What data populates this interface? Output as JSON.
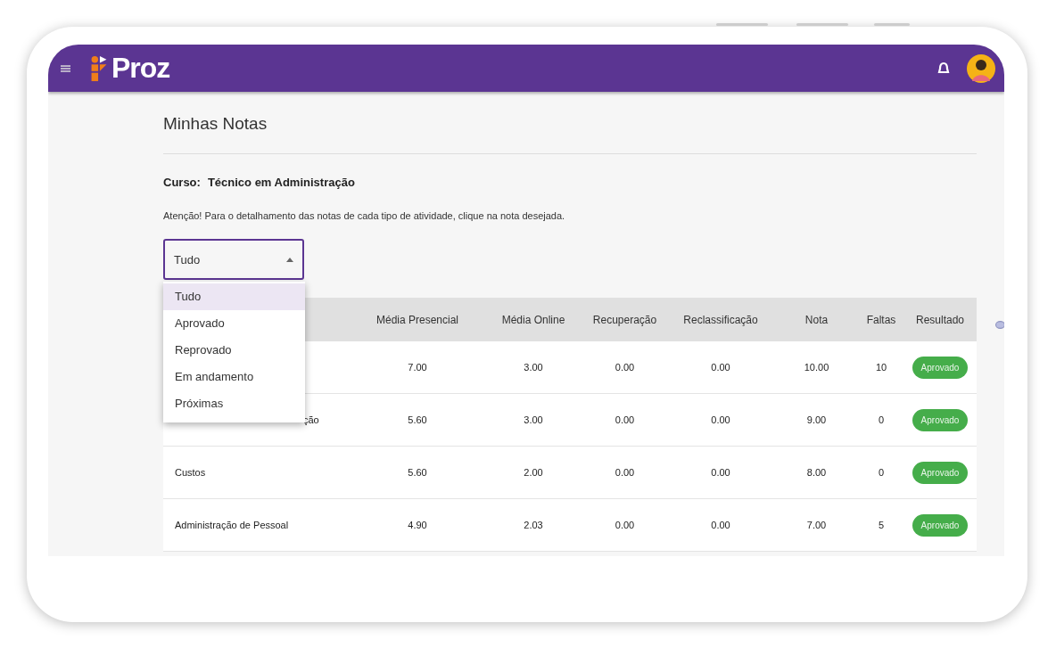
{
  "app_bar": {
    "logo": "Proz"
  },
  "page_title": "Minhas Notas",
  "course": {
    "label": "Curso:",
    "value": "Técnico em Administração"
  },
  "notice": "Atenção! Para o detalhamento das notas de cada tipo de atividade, clique na nota desejada.",
  "filter": {
    "value": "Tudo",
    "expanded": true,
    "options": [
      {
        "label": "Tudo",
        "selected": true
      },
      {
        "label": "Aprovado",
        "selected": false
      },
      {
        "label": "Reprovado",
        "selected": false
      },
      {
        "label": "Em andamento",
        "selected": false
      },
      {
        "label": "Próximas",
        "selected": false
      }
    ]
  },
  "table": {
    "columns": [
      "Média Presencial",
      "Média Online",
      "Recuperação",
      "Reclassificação",
      "Nota",
      "Faltas",
      "Resultado"
    ],
    "rows": [
      {
        "cells": [
          "7.00",
          "3.00",
          "0.00",
          "0.00",
          "10.00",
          "10"
        ],
        "result": "Aprovado"
      },
      {
        "subject": "ção",
        "covered": true,
        "cells": [
          "5.60",
          "3.00",
          "0.00",
          "0.00",
          "9.00",
          "0"
        ],
        "result": "Aprovado"
      },
      {
        "subject": "Custos",
        "covered": false,
        "cells": [
          "5.60",
          "2.00",
          "0.00",
          "0.00",
          "8.00",
          "0"
        ],
        "result": "Aprovado"
      },
      {
        "subject": "Administração de Pessoal",
        "covered": false,
        "cells": [
          "4.90",
          "2.03",
          "0.00",
          "0.00",
          "7.00",
          "5"
        ],
        "result": "Aprovado"
      }
    ]
  }
}
